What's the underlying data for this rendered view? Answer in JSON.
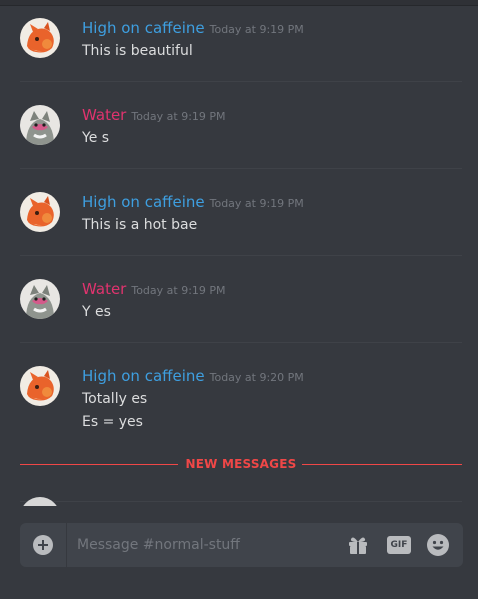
{
  "colors": {
    "background": "#36393f",
    "author_blue": "#3e9fe0",
    "author_pink": "#e0336e",
    "timestamp": "#72767d",
    "text": "#dcddde",
    "new_messages": "#f04747"
  },
  "messages": [
    {
      "author": "High on caffeine",
      "author_color": "#3e9fe0",
      "avatar": "fox-avatar",
      "timestamp": "Today at 9:19 PM",
      "lines": [
        "This is beautiful"
      ]
    },
    {
      "author": "Water",
      "author_color": "#e0336e",
      "avatar": "cat-avatar",
      "timestamp": "Today at 9:19 PM",
      "lines": [
        "Ye s"
      ]
    },
    {
      "author": "High on caffeine",
      "author_color": "#3e9fe0",
      "avatar": "fox-avatar",
      "timestamp": "Today at 9:19 PM",
      "lines": [
        "This is a hot bae"
      ]
    },
    {
      "author": "Water",
      "author_color": "#e0336e",
      "avatar": "cat-avatar",
      "timestamp": "Today at 9:19 PM",
      "lines": [
        "Y es"
      ]
    },
    {
      "author": "High on caffeine",
      "author_color": "#3e9fe0",
      "avatar": "fox-avatar",
      "timestamp": "Today at 9:20 PM",
      "lines": [
        "Totally es",
        "Es = yes"
      ]
    }
  ],
  "new_messages_label": "NEW MESSAGES",
  "composer": {
    "placeholder": "Message #normal-stuff",
    "add_icon": "plus-circle-icon",
    "gift_icon": "gift-icon",
    "gif_label": "GIF",
    "emoji_icon": "smiley-icon"
  }
}
